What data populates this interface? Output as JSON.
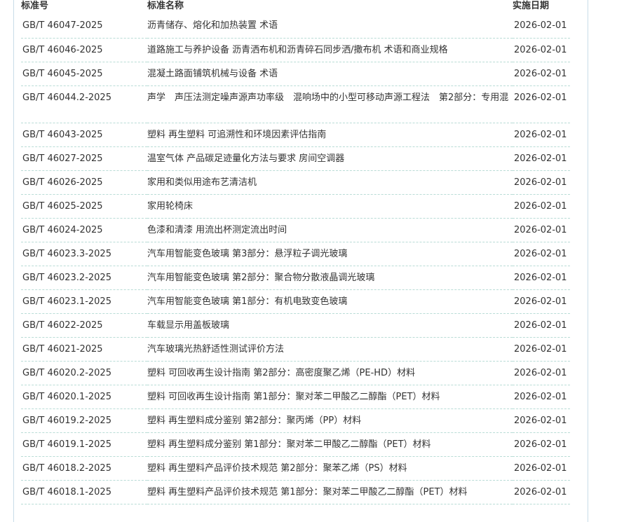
{
  "table": {
    "headers": {
      "number": "标准号",
      "name": "标准名称",
      "date": "实施日期"
    },
    "rows": [
      {
        "number": "GB/T 46047-2025",
        "name": "沥青储存、熔化和加热装置 术语",
        "date": "2026-02-01"
      },
      {
        "number": "GB/T 46046-2025",
        "name": "道路施工与养护设备 沥青洒布机和沥青碎石同步洒/撒布机 术语和商业规格",
        "date": "2026-02-01"
      },
      {
        "number": "GB/T 46045-2025",
        "name": "混凝土路面铺筑机械与设备 术语",
        "date": "2026-02-01"
      },
      {
        "number": "GB/T 46044.2-2025",
        "name": "声学　声压法测定噪声源声功率级　混响场中的小型可移动声源工程法　第2部分：专用混",
        "date": "2026-02-01"
      },
      {
        "number": "GB/T 46043-2025",
        "name": "塑料 再生塑料 可追溯性和环境因素评估指南",
        "date": "2026-02-01"
      },
      {
        "number": "GB/T 46027-2025",
        "name": "温室气体 产品碳足迹量化方法与要求 房间空调器",
        "date": "2026-02-01"
      },
      {
        "number": "GB/T 46026-2025",
        "name": "家用和类似用途布艺清洁机",
        "date": "2026-02-01"
      },
      {
        "number": "GB/T 46025-2025",
        "name": "家用轮椅床",
        "date": "2026-02-01"
      },
      {
        "number": "GB/T 46024-2025",
        "name": "色漆和清漆 用流出杯测定流出时间",
        "date": "2026-02-01"
      },
      {
        "number": "GB/T 46023.3-2025",
        "name": "汽车用智能变色玻璃 第3部分：悬浮粒子调光玻璃",
        "date": "2026-02-01"
      },
      {
        "number": "GB/T 46023.2-2025",
        "name": "汽车用智能变色玻璃 第2部分：聚合物分散液晶调光玻璃",
        "date": "2026-02-01"
      },
      {
        "number": "GB/T 46023.1-2025",
        "name": "汽车用智能变色玻璃 第1部分：有机电致变色玻璃",
        "date": "2026-02-01"
      },
      {
        "number": "GB/T 46022-2025",
        "name": "车载显示用盖板玻璃",
        "date": "2026-02-01"
      },
      {
        "number": "GB/T 46021-2025",
        "name": "汽车玻璃光热舒适性测试评价方法",
        "date": "2026-02-01"
      },
      {
        "number": "GB/T 46020.2-2025",
        "name": "塑料 可回收再生设计指南 第2部分：高密度聚乙烯（PE-HD）材料",
        "date": "2026-02-01"
      },
      {
        "number": "GB/T 46020.1-2025",
        "name": "塑料 可回收再生设计指南 第1部分：聚对苯二甲酸乙二醇酯（PET）材料",
        "date": "2026-02-01"
      },
      {
        "number": "GB/T 46019.2-2025",
        "name": "塑料 再生塑料成分鉴别 第2部分：聚丙烯（PP）材料",
        "date": "2026-02-01"
      },
      {
        "number": "GB/T 46019.1-2025",
        "name": "塑料 再生塑料成分鉴别 第1部分：聚对苯二甲酸乙二醇酯（PET）材料",
        "date": "2026-02-01"
      },
      {
        "number": "GB/T 46018.2-2025",
        "name": "塑料 再生塑料产品评价技术规范 第2部分：聚苯乙烯（PS）材料",
        "date": "2026-02-01"
      },
      {
        "number": "GB/T 46018.1-2025",
        "name": "塑料 再生塑料产品评价技术规范 第1部分：聚对苯二甲酸乙二醇酯（PET）材料",
        "date": "2026-02-01"
      }
    ]
  }
}
